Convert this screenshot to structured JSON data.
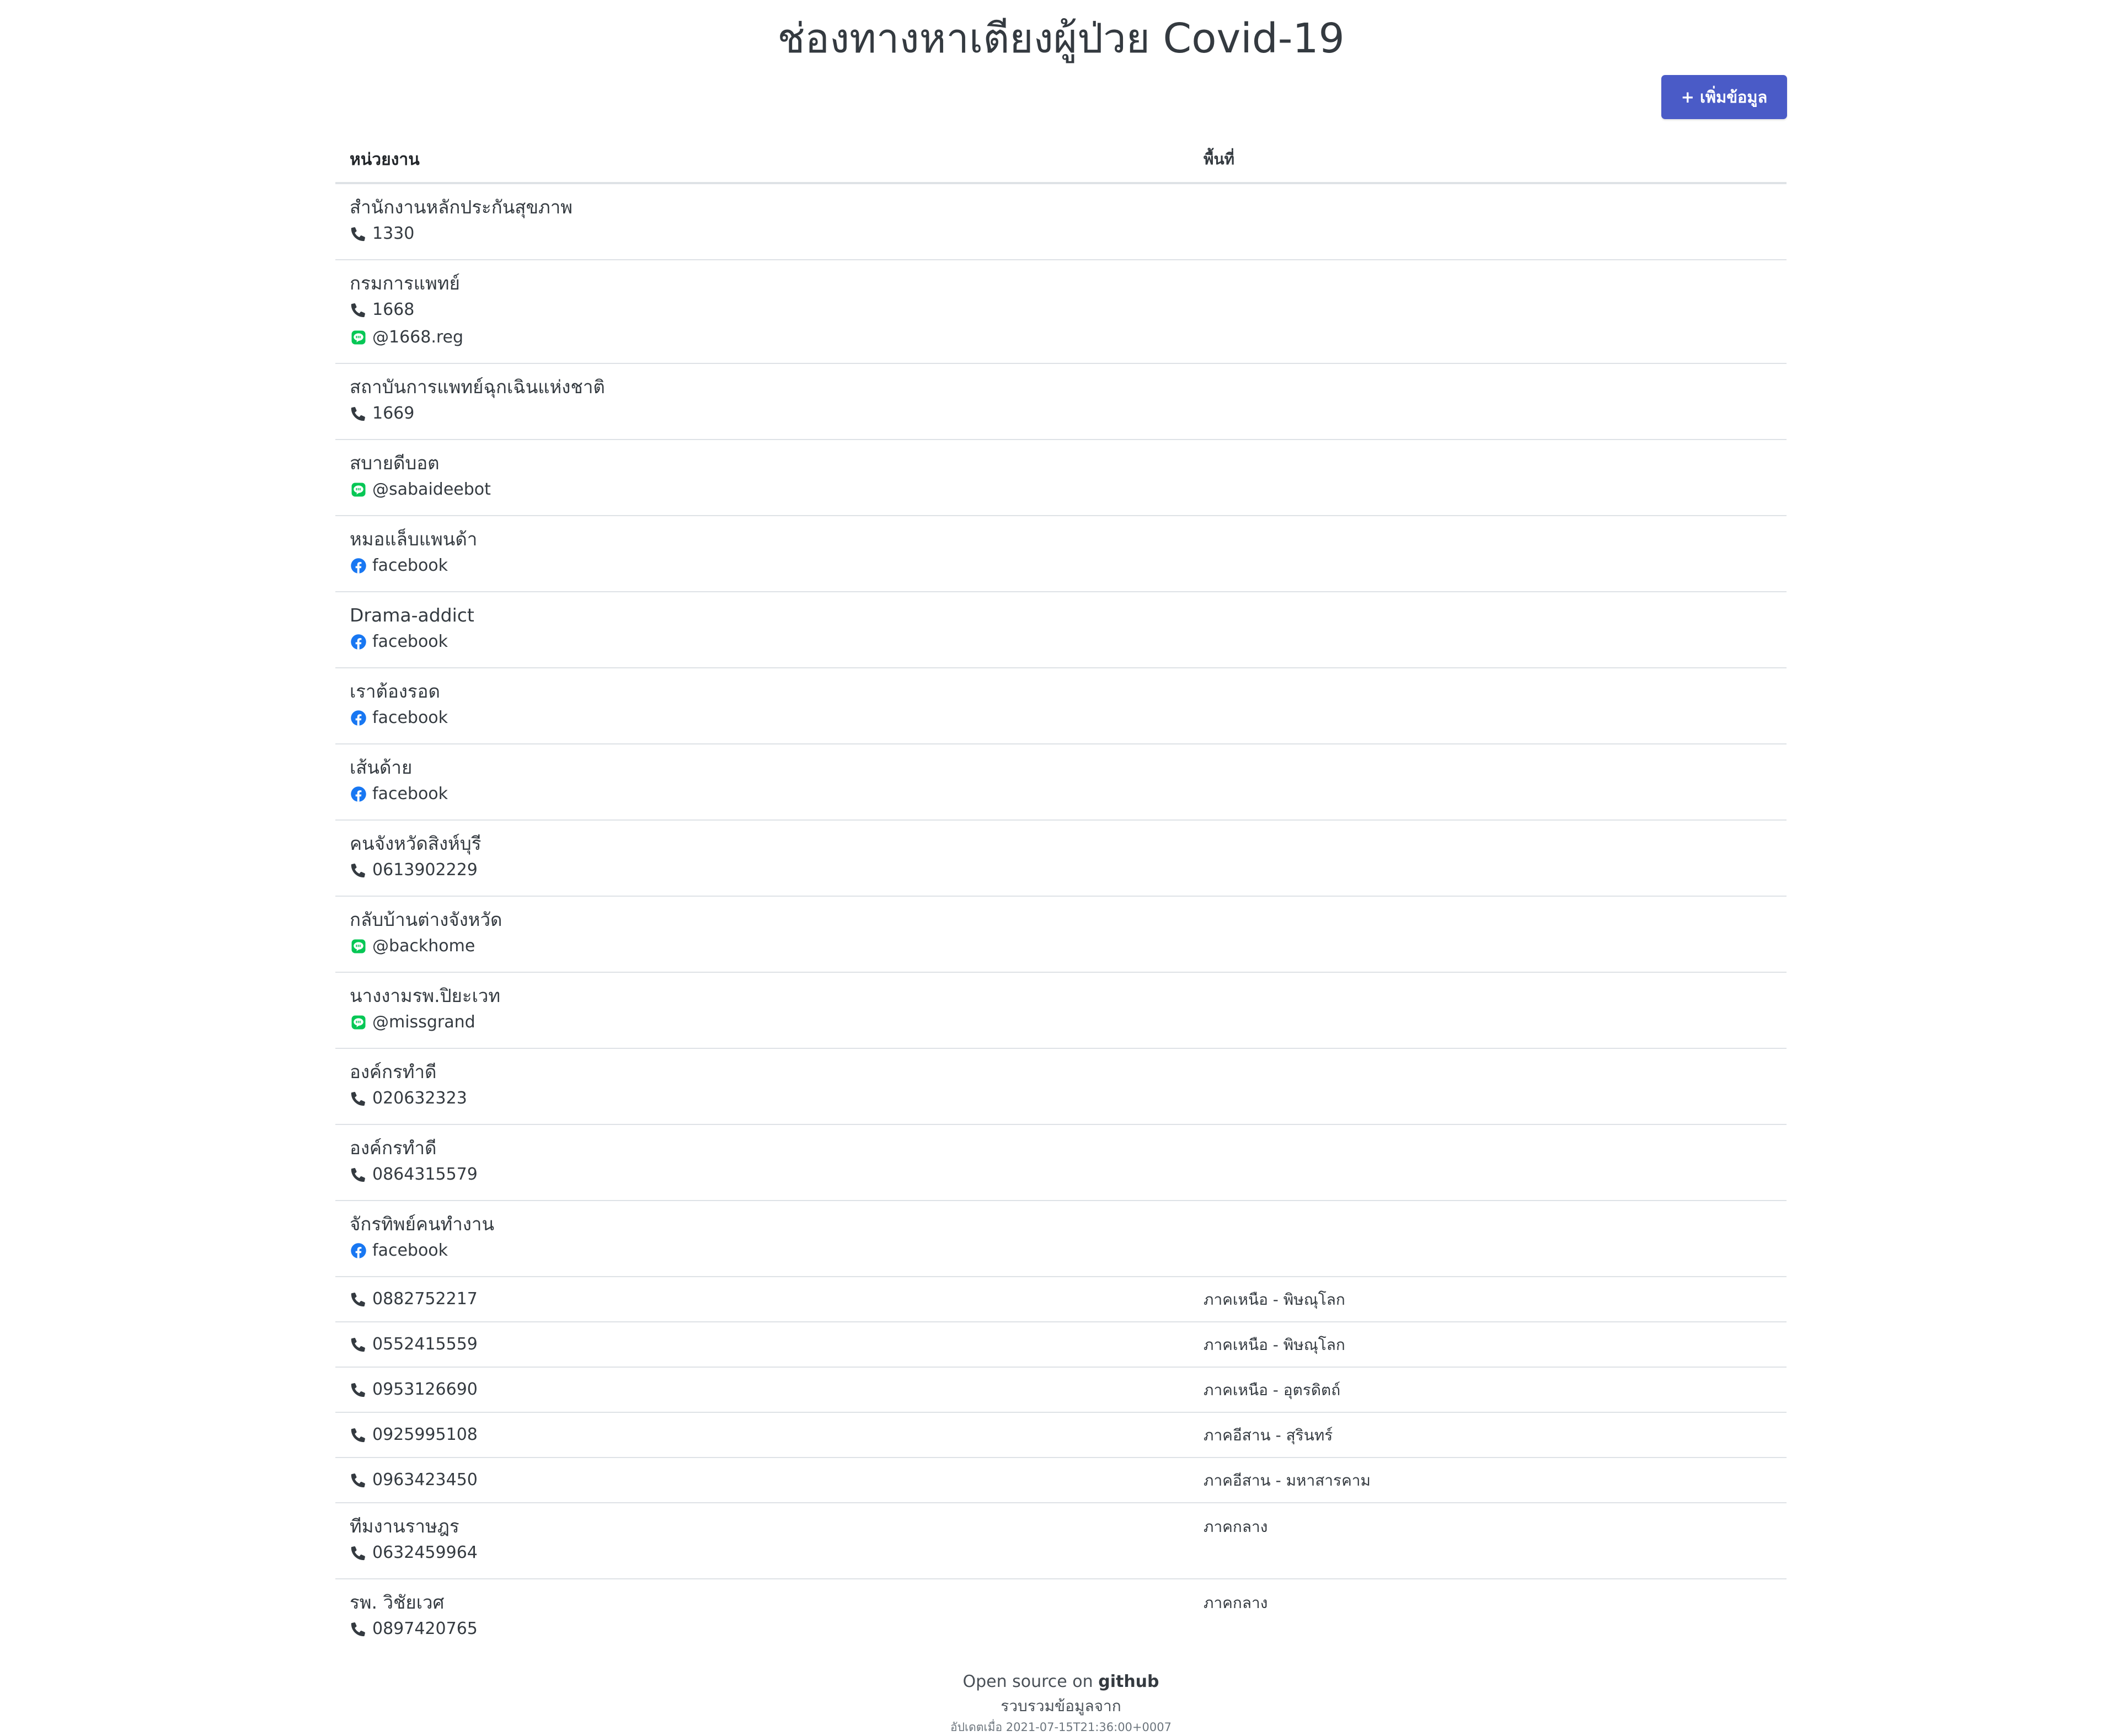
{
  "page": {
    "title": "ช่องทางหาเตียงผู้ป่วย Covid-19",
    "add_button": {
      "label": "+ เพิ่มข้อมูล"
    }
  },
  "table": {
    "headers": {
      "org": "หน่วยงาน",
      "area": "พื้นที่"
    },
    "rows": [
      {
        "name": "สำนักงานหลักประกันสุขภาพ",
        "contacts": [
          {
            "type": "phone-icon",
            "text": "1330"
          }
        ],
        "area": ""
      },
      {
        "name": "กรมการแพทย์",
        "contacts": [
          {
            "type": "phone-icon",
            "text": "1668"
          },
          {
            "type": "line-icon",
            "text": "@1668.reg"
          }
        ],
        "area": ""
      },
      {
        "name": "สถาบันการแพทย์ฉุกเฉินแห่งชาติ",
        "contacts": [
          {
            "type": "phone-icon",
            "text": "1669"
          }
        ],
        "area": ""
      },
      {
        "name": "สบายดีบอต",
        "contacts": [
          {
            "type": "line-icon",
            "text": "@sabaideebot"
          }
        ],
        "area": ""
      },
      {
        "name": "หมอแล็บแพนด้า",
        "contacts": [
          {
            "type": "facebook-icon",
            "text": "facebook"
          }
        ],
        "area": ""
      },
      {
        "name": "Drama-addict",
        "contacts": [
          {
            "type": "facebook-icon",
            "text": "facebook"
          }
        ],
        "area": ""
      },
      {
        "name": "เราต้องรอด",
        "contacts": [
          {
            "type": "facebook-icon",
            "text": "facebook"
          }
        ],
        "area": ""
      },
      {
        "name": "เส้นด้าย",
        "contacts": [
          {
            "type": "facebook-icon",
            "text": "facebook"
          }
        ],
        "area": ""
      },
      {
        "name": "คนจังหวัดสิงห์บุรี",
        "contacts": [
          {
            "type": "phone-icon",
            "text": "0613902229"
          }
        ],
        "area": ""
      },
      {
        "name": "กลับบ้านต่างจังหวัด",
        "contacts": [
          {
            "type": "line-icon",
            "text": "@backhome"
          }
        ],
        "area": ""
      },
      {
        "name": "นางงามรพ.ปิยะเวท",
        "contacts": [
          {
            "type": "line-icon",
            "text": "@missgrand"
          }
        ],
        "area": ""
      },
      {
        "name": "องค์กรทำดี",
        "contacts": [
          {
            "type": "phone-icon",
            "text": "020632323"
          }
        ],
        "area": ""
      },
      {
        "name": "องค์กรทำดี",
        "contacts": [
          {
            "type": "phone-icon",
            "text": "0864315579"
          }
        ],
        "area": ""
      },
      {
        "name": "จักรทิพย์คนทำงาน",
        "contacts": [
          {
            "type": "facebook-icon",
            "text": "facebook"
          }
        ],
        "area": ""
      },
      {
        "name": "",
        "contacts": [
          {
            "type": "phone-icon",
            "text": "0882752217"
          }
        ],
        "area": "ภาคเหนือ - พิษณุโลก"
      },
      {
        "name": "",
        "contacts": [
          {
            "type": "phone-icon",
            "text": "0552415559"
          }
        ],
        "area": "ภาคเหนือ - พิษณุโลก"
      },
      {
        "name": "",
        "contacts": [
          {
            "type": "phone-icon",
            "text": "0953126690"
          }
        ],
        "area": "ภาคเหนือ - อุตรดิตถ์"
      },
      {
        "name": "",
        "contacts": [
          {
            "type": "phone-icon",
            "text": "0925995108"
          }
        ],
        "area": "ภาคอีสาน - สุรินทร์"
      },
      {
        "name": "",
        "contacts": [
          {
            "type": "phone-icon",
            "text": "0963423450"
          }
        ],
        "area": "ภาคอีสาน - มหาสารคาม"
      },
      {
        "name": "ทีมงานราษฎร",
        "contacts": [
          {
            "type": "phone-icon",
            "text": "0632459964"
          }
        ],
        "area": "ภาคกลาง"
      },
      {
        "name": "รพ. วิชัยเวศ",
        "contacts": [
          {
            "type": "phone-icon",
            "text": "0897420765"
          }
        ],
        "area": "ภาคกลาง"
      }
    ]
  },
  "footer": {
    "open_source_prefix": "Open source on",
    "github_link": "github",
    "collected_from": "รวบรวมข้อมูลจาก",
    "updated": "อัปเดตเมื่อ 2021-07-15T21:36:00+0007"
  },
  "colors": {
    "primary_button": "#4a5bc7",
    "line_green": "#06c755",
    "facebook_blue": "#1877f2",
    "text": "#343a40"
  }
}
